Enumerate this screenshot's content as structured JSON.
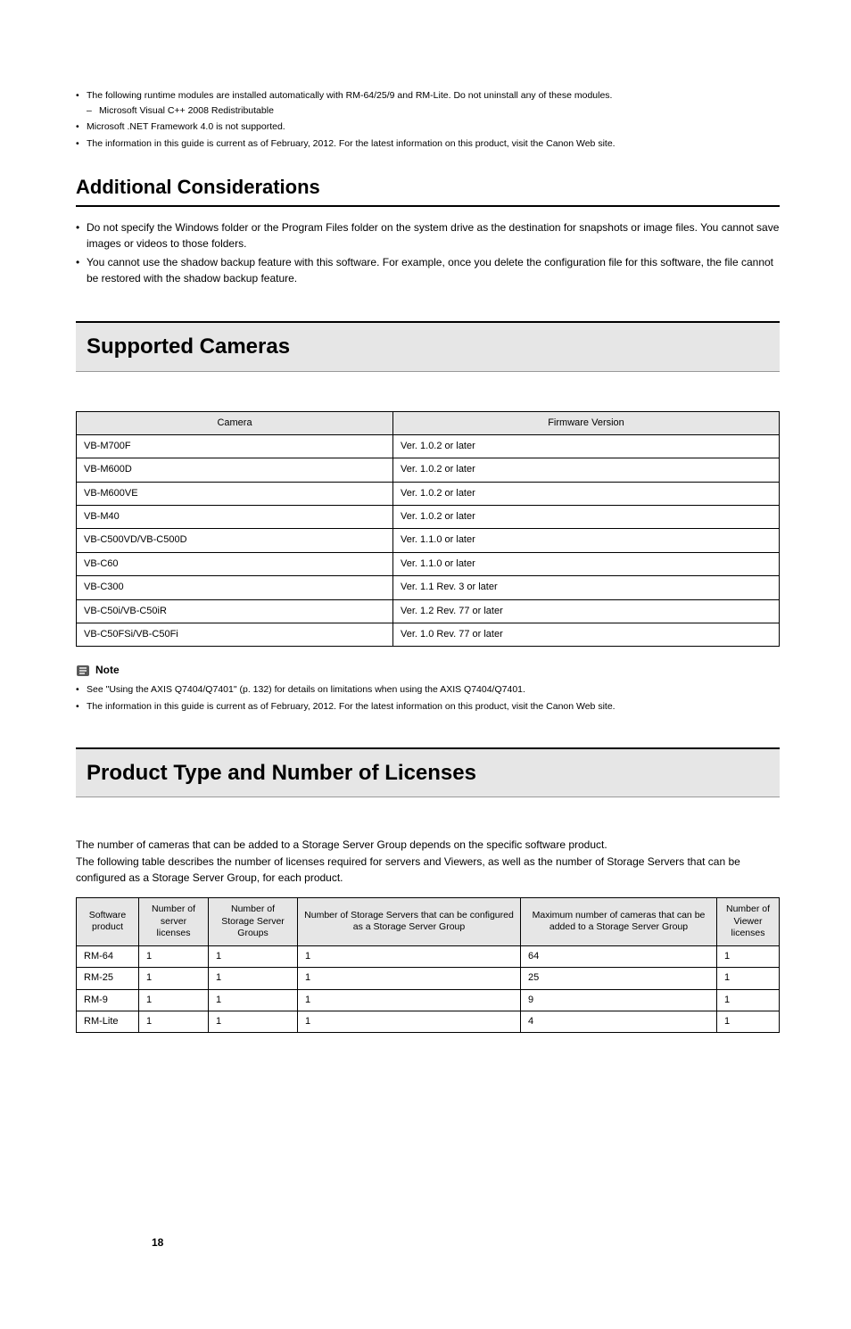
{
  "top_notes": [
    {
      "text": "The following runtime modules are installed automatically with RM-64/25/9 and RM-Lite. Do not uninstall any of these modules.",
      "sub": [
        "Microsoft Visual C++ 2008 Redistributable"
      ]
    },
    {
      "text": "Microsoft .NET Framework 4.0 is not supported."
    },
    {
      "text": "The information in this guide is current as of February, 2012. For the latest information on this product, visit the Canon Web site."
    }
  ],
  "additional": {
    "heading": "Additional Considerations",
    "items": [
      "Do not specify the Windows folder or the Program Files folder on the system drive as the destination for snapshots or image files. You cannot save images or videos to those folders.",
      "You cannot use the shadow backup feature with this software. For example, once you delete the configuration file for this software, the file cannot be restored with the shadow backup feature."
    ]
  },
  "cameras": {
    "heading": "Supported Cameras",
    "cols": [
      "Camera",
      "Firmware Version"
    ],
    "rows": [
      [
        "VB-M700F",
        "Ver. 1.0.2 or later"
      ],
      [
        "VB-M600D",
        "Ver. 1.0.2 or later"
      ],
      [
        "VB-M600VE",
        "Ver. 1.0.2 or later"
      ],
      [
        "VB-M40",
        "Ver. 1.0.2 or later"
      ],
      [
        "VB-C500VD/VB-C500D",
        "Ver. 1.1.0 or later"
      ],
      [
        "VB-C60",
        "Ver. 1.1.0 or later"
      ],
      [
        "VB-C300",
        "Ver. 1.1 Rev. 3 or later"
      ],
      [
        "VB-C50i/VB-C50iR",
        "Ver. 1.2 Rev. 77 or later"
      ],
      [
        "VB-C50FSi/VB-C50Fi",
        "Ver. 1.0 Rev. 77 or later"
      ]
    ]
  },
  "note_label": "Note",
  "camera_notes": [
    "See \"Using the AXIS Q7404/Q7401\" (p. 132) for details on limitations when using the AXIS Q7404/Q7401.",
    "The information in this guide is current as of February, 2012. For the latest information on this product, visit the Canon Web site."
  ],
  "licenses": {
    "heading": "Product Type and Number of Licenses",
    "intro": "The number of cameras that can be added to a Storage Server Group depends on the specific software product.\nThe following table describes the number of licenses required for servers and Viewers, as well as the number of Storage Servers that can be configured as a Storage Server Group, for each product.",
    "cols": [
      "Software product",
      "Number of server licenses",
      "Number of Storage Server Groups",
      "Number of Storage Servers that can be configured as a Storage Server Group",
      "Maximum number of cameras that can be added to a Storage Server Group",
      "Number of Viewer licenses"
    ],
    "rows": [
      [
        "RM-64",
        "1",
        "1",
        "1",
        "64",
        "1"
      ],
      [
        "RM-25",
        "1",
        "1",
        "1",
        "25",
        "1"
      ],
      [
        "RM-9",
        "1",
        "1",
        "1",
        "9",
        "1"
      ],
      [
        "RM-Lite",
        "1",
        "1",
        "1",
        "4",
        "1"
      ]
    ]
  },
  "page": "18"
}
